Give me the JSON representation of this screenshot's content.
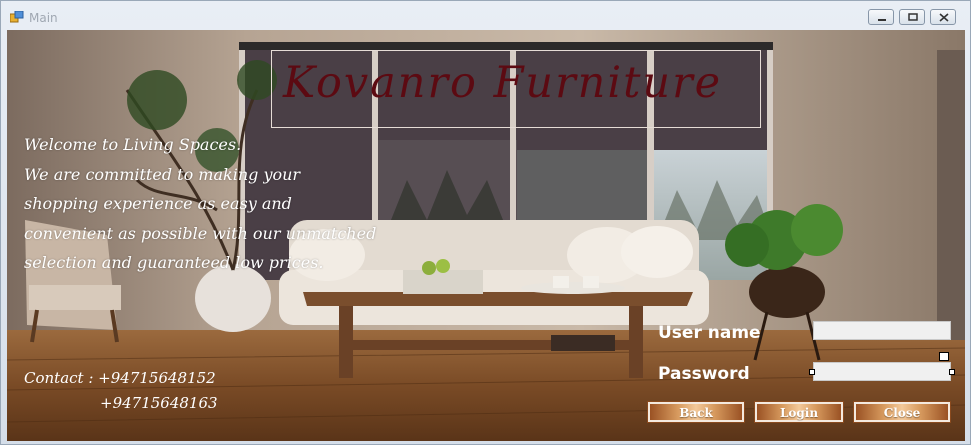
{
  "window": {
    "title": "Main",
    "minimize_icon": "minimize-icon",
    "maximize_icon": "maximize-icon",
    "close_icon": "close-icon"
  },
  "hero": {
    "heading": "Kovanro Furniture",
    "welcome_lines": [
      "Welcome to Living Spaces.",
      "We are committed to making your",
      "shopping experience as easy and",
      "convenient as possible with our unmatched",
      "selection and guaranteed low prices."
    ],
    "contact_line1": "Contact : +94715648152",
    "contact_line2": "+94715648163"
  },
  "login": {
    "username_label": "User name",
    "username_value": "",
    "password_label": "Password",
    "password_value": "",
    "back_label": "Back",
    "login_label": "Login",
    "close_label": "Close"
  },
  "colors": {
    "heading": "#5c0a12",
    "button_wood": "#d79a5e"
  }
}
